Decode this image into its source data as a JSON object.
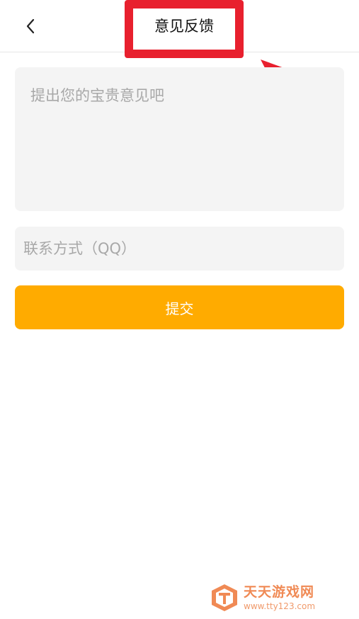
{
  "header": {
    "title": "意见反馈"
  },
  "form": {
    "feedback_placeholder": "提出您的宝贵意见吧",
    "contact_placeholder": "联系方式（QQ）",
    "submit_label": "提交"
  },
  "watermark": {
    "name": "天天游戏网",
    "url": "www.tty123.com"
  },
  "colors": {
    "accent": "#ffab00",
    "highlight": "#e8202e",
    "field_bg": "#f4f4f4",
    "watermark": "#f08a55"
  },
  "icons": {
    "back": "chevron-left-icon",
    "annotation": "arrow-icon",
    "logo": "site-logo-icon"
  }
}
